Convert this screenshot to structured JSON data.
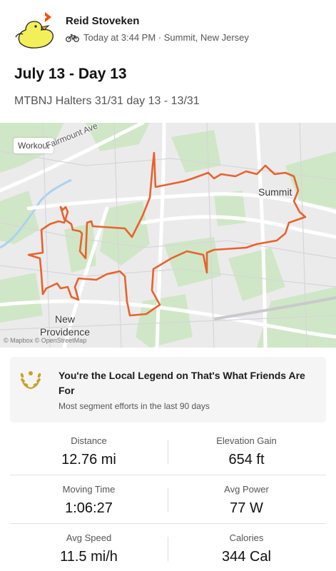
{
  "activity": {
    "user_name": "Reid Stoveken",
    "meta": "Today at 3:44 PM · Summit, New Jersey",
    "title": "July 13 - Day 13",
    "description": "MTBNJ Halters 31/31 day 13 - 13/31",
    "icons": [
      "avatar",
      "bike-icon",
      "strava-chevron-badge"
    ]
  },
  "map": {
    "tag": "Workout",
    "labels": {
      "fairmount": "Fairmount Ave",
      "summit": "Summit",
      "new_providence_line1": "New",
      "new_providence_line2": "Providence",
      "credit": "© Mapbox © OpenStreetMap"
    },
    "route_color": "#e8622c"
  },
  "local_legend": {
    "title": "You're the Local Legend on That's What Friends Are For",
    "subtitle": "Most segment efforts in the last 90 days",
    "icon": "laurel-icon",
    "icon_color": "#c9a227"
  },
  "stats": [
    {
      "label": "Distance",
      "value": "12.76 mi"
    },
    {
      "label": "Elevation Gain",
      "value": "654 ft"
    },
    {
      "label": "Moving Time",
      "value": "1:06:27"
    },
    {
      "label": "Avg Power",
      "value": "77 W"
    },
    {
      "label": "Avg Speed",
      "value": "11.5 mi/h"
    },
    {
      "label": "Calories",
      "value": "344 Cal"
    }
  ]
}
